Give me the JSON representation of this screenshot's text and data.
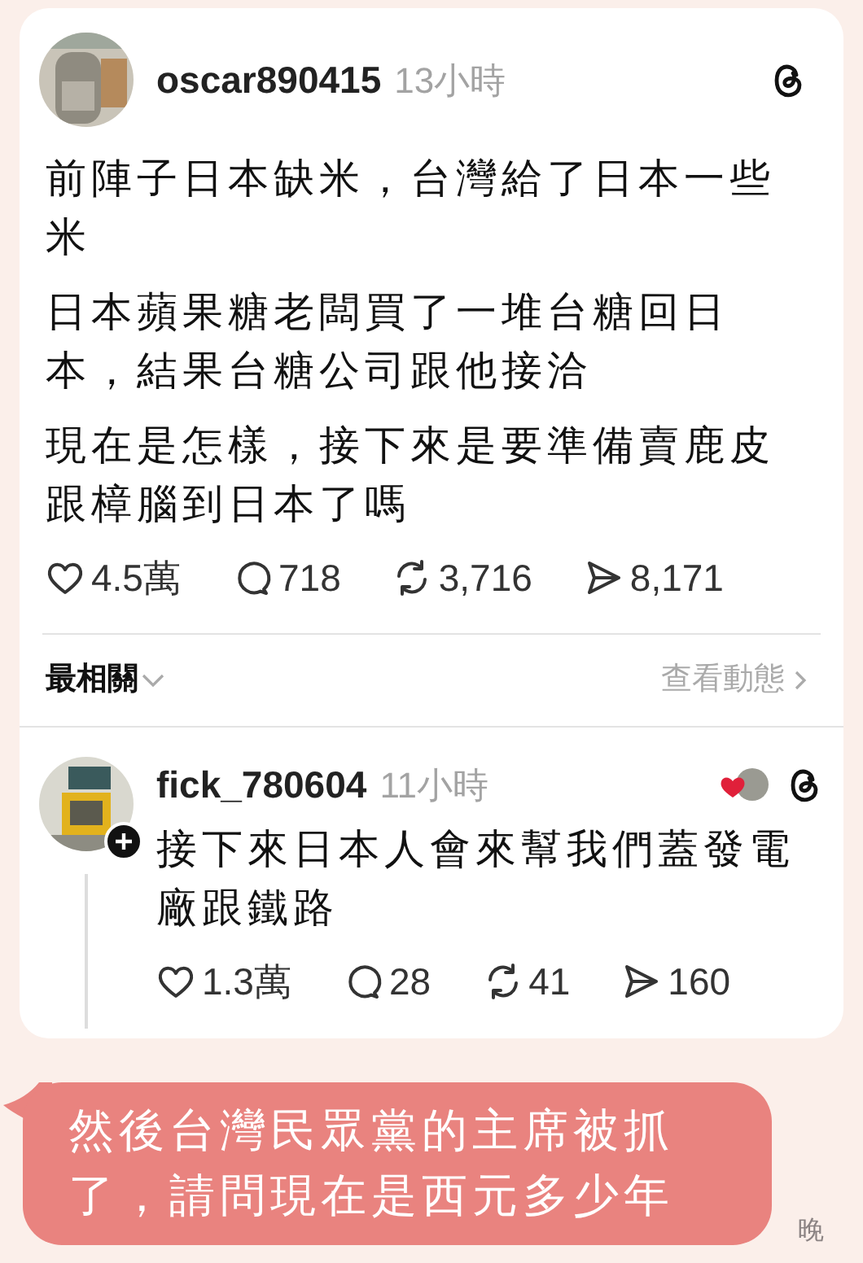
{
  "post": {
    "username": "oscar890415",
    "time": "13小時",
    "paragraphs": [
      "前陣子日本缺米，台灣給了日本一些米",
      "日本蘋果糖老闆買了一堆台糖回日本，結果台糖公司跟他接洽",
      "現在是怎樣，接下來是要準備賣鹿皮跟樟腦到日本了嗎"
    ],
    "stats": [
      {
        "kind": "like",
        "value": "4.5萬"
      },
      {
        "kind": "comment",
        "value": "718"
      },
      {
        "kind": "repost",
        "value": "3,716"
      },
      {
        "kind": "share",
        "value": "8,171"
      }
    ]
  },
  "sort": {
    "label": "最相關",
    "link": "查看動態"
  },
  "reply": {
    "username": "fick_780604",
    "time": "11小時",
    "text": "接下來日本人會來幫我們蓋發電廠跟鐵路",
    "stats": [
      {
        "kind": "like",
        "value": "1.3萬"
      },
      {
        "kind": "comment",
        "value": "28"
      },
      {
        "kind": "repost",
        "value": "41"
      },
      {
        "kind": "share",
        "value": "160"
      }
    ]
  },
  "message": {
    "text": "然後台灣民眾黨的主席被抓了，請問現在是西元多少年",
    "time": "晚"
  }
}
